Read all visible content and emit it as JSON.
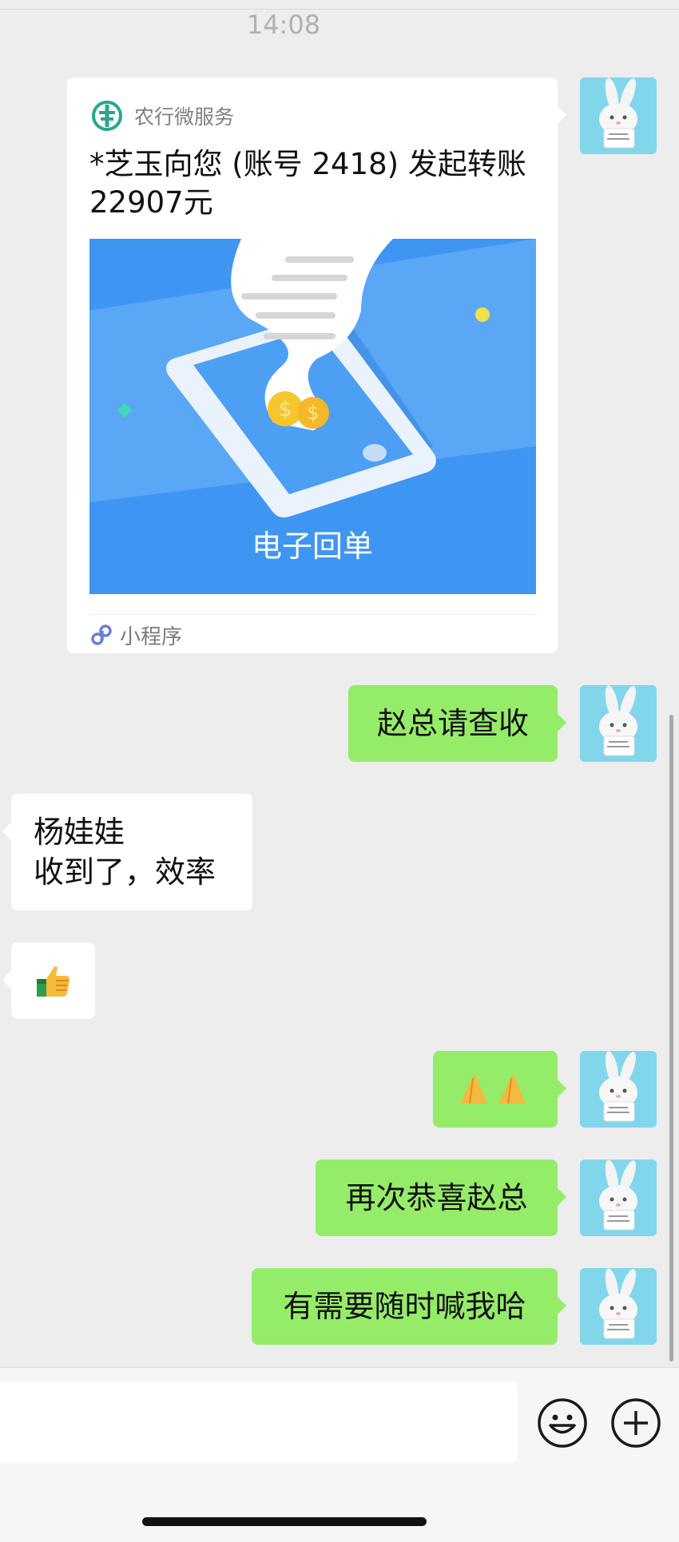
{
  "status": {
    "time": "14:08"
  },
  "card": {
    "source": "农行微服务",
    "title": "*芝玉向您 (账号 2418) 发起转账\n22907元",
    "image_caption": "电子回单",
    "footer": "小程序"
  },
  "messages": {
    "m1": "赵总请查收",
    "m2": "杨娃娃\n收到了，效率",
    "m3_icon": "thumbs-up-emoji",
    "m4_icon": "praying-hands-emoji",
    "m5": "再次恭喜赵总",
    "m6": "有需要随时喊我哈"
  },
  "input": {
    "value": "",
    "placeholder": ""
  },
  "icons": {
    "emoji": "smiley-icon",
    "more": "plus-icon"
  },
  "colors": {
    "sent_bubble": "#95ec69",
    "received_bubble": "#ffffff",
    "background": "#ededed"
  }
}
